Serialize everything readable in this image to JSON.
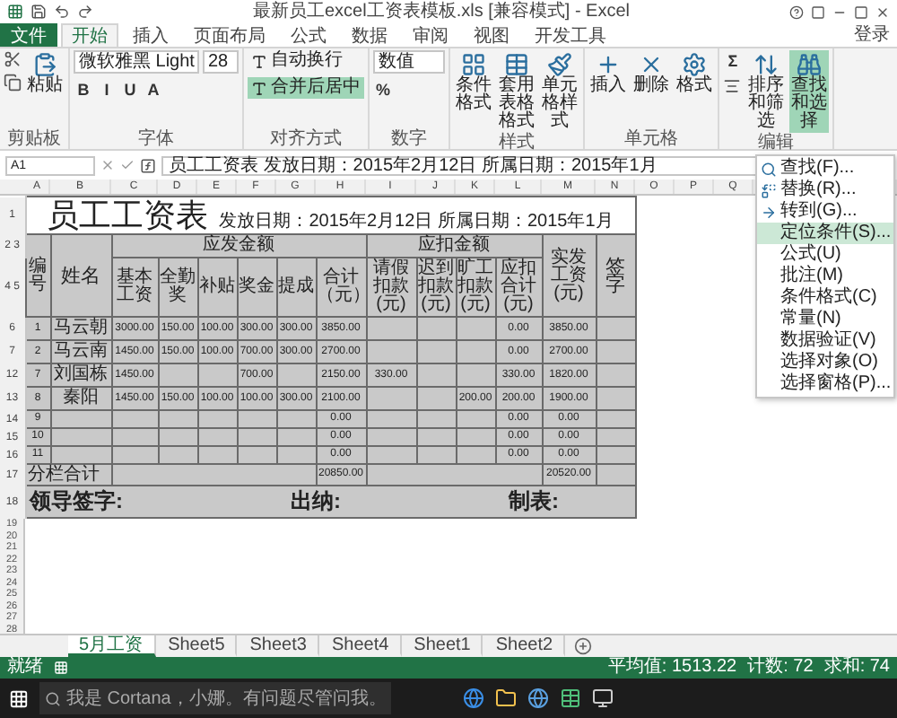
{
  "window": {
    "title": "最新员工excel工资表模板.xls [兼容模式] - Excel"
  },
  "menu_tabs": [
    {
      "label": "文件",
      "kind": "file",
      "selected": false
    },
    {
      "label": "开始",
      "kind": "tab",
      "selected": true
    },
    {
      "label": "插入",
      "kind": "tab",
      "selected": false
    },
    {
      "label": "页面布局",
      "kind": "tab",
      "selected": false
    },
    {
      "label": "公式",
      "kind": "tab",
      "selected": false
    },
    {
      "label": "数据",
      "kind": "tab",
      "selected": false
    },
    {
      "label": "审阅",
      "kind": "tab",
      "selected": false
    },
    {
      "label": "视图",
      "kind": "tab",
      "selected": false
    },
    {
      "label": "开发工具",
      "kind": "tab",
      "selected": false
    }
  ],
  "login": "登录",
  "ribbon": [
    {
      "label": "剪贴板",
      "items": [
        {
          "kind": "big",
          "label": "粘贴",
          "selected": false
        }
      ],
      "rows": [
        [
          {
            "kind": "icon"
          }
        ],
        [
          {
            "kind": "icon"
          }
        ]
      ]
    },
    {
      "label": "字体",
      "fields": [
        {
          "kind": "font",
          "value": "微软雅黑 Light"
        },
        {
          "kind": "size",
          "value": "28"
        }
      ],
      "buttons": [
        {
          "kind": "glyph",
          "label": "B"
        },
        {
          "kind": "glyph",
          "label": "I"
        },
        {
          "kind": "glyph",
          "label": "U"
        },
        {
          "kind": "glyph",
          "label": "A"
        }
      ]
    },
    {
      "label": "对齐方式",
      "rows": [
        [
          {
            "kind": "wide",
            "label": "自动换行",
            "selected": false
          }
        ],
        [
          {
            "kind": "wide",
            "label": "合并后居中",
            "selected": true
          }
        ]
      ]
    },
    {
      "label": "数字",
      "rows": [
        [
          {
            "kind": "format",
            "value": "数值"
          }
        ],
        [
          {
            "kind": "glyph",
            "label": "%"
          }
        ]
      ]
    },
    {
      "label": "样式",
      "items": [
        {
          "kind": "big",
          "label": "条件格式",
          "selected": false
        },
        {
          "kind": "big",
          "label": "套用表格格式",
          "selected": false
        },
        {
          "kind": "big",
          "label": "单元格样式",
          "selected": false
        }
      ]
    },
    {
      "label": "单元格",
      "items": [
        {
          "kind": "big",
          "label": "插入",
          "selected": false
        },
        {
          "kind": "big",
          "label": "删除",
          "selected": false
        },
        {
          "kind": "big",
          "label": "格式",
          "selected": false
        }
      ]
    },
    {
      "label": "编辑",
      "rows": [
        [
          {
            "kind": "glyph",
            "label": "Σ"
          }
        ],
        [
          {
            "kind": "icon"
          }
        ]
      ],
      "items": [
        {
          "kind": "big",
          "label": "排序和筛选",
          "selected": false
        },
        {
          "kind": "big",
          "label": "查找和选择",
          "selected": true
        }
      ]
    }
  ],
  "formula_bar": {
    "cell": "A1",
    "content": "员工工资表  发放日期：2015年2月12日  所属日期：2015年1月"
  },
  "column_letters": [
    "A",
    "B",
    "C",
    "D",
    "E",
    "F",
    "G",
    "H",
    "I",
    "J",
    "K",
    "L",
    "M",
    "N",
    "O",
    "P",
    "Q"
  ],
  "sheet": {
    "title_row": {
      "num": "1",
      "title": "员工工资表",
      "subtitle": "发放日期：2015年2月12日 所属日期：2015年1月"
    },
    "group_row_nums": [
      "2",
      "3"
    ],
    "label_row_nums": [
      "4",
      "5"
    ],
    "groups": [
      "应发金额",
      "应扣金额"
    ],
    "columns": [
      "编号",
      "姓名",
      "基本工资",
      "全勤奖",
      "补贴",
      "奖金",
      "提成",
      "合计（元）",
      "请假扣款(元)",
      "迟到扣款(元)",
      "旷工扣款(元)",
      "应扣合计(元)",
      "实发工资(元)",
      "签字"
    ],
    "rows": [
      {
        "num": "6",
        "cells": [
          "1",
          "马云朝",
          "3000.00",
          "150.00",
          "100.00",
          "300.00",
          "300.00",
          "3850.00",
          "",
          "",
          "",
          "0.00",
          "3850.00",
          ""
        ]
      },
      {
        "num": "7",
        "cells": [
          "2",
          "马云南",
          "1450.00",
          "150.00",
          "100.00",
          "700.00",
          "300.00",
          "2700.00",
          "",
          "",
          "",
          "0.00",
          "2700.00",
          ""
        ]
      },
      {
        "num": "12",
        "cells": [
          "7",
          "刘国栋",
          "1450.00",
          "",
          "",
          "700.00",
          "",
          "2150.00",
          "330.00",
          "",
          "",
          "330.00",
          "1820.00",
          ""
        ]
      },
      {
        "num": "13",
        "cells": [
          "8",
          "秦阳",
          "1450.00",
          "150.00",
          "100.00",
          "100.00",
          "300.00",
          "2100.00",
          "",
          "",
          "200.00",
          "200.00",
          "1900.00",
          ""
        ]
      },
      {
        "num": "14",
        "cells": [
          "9",
          "",
          "",
          "",
          "",
          "",
          "",
          "0.00",
          "",
          "",
          "",
          "0.00",
          "0.00",
          ""
        ]
      },
      {
        "num": "15",
        "cells": [
          "10",
          "",
          "",
          "",
          "",
          "",
          "",
          "0.00",
          "",
          "",
          "",
          "0.00",
          "0.00",
          ""
        ]
      },
      {
        "num": "16",
        "cells": [
          "11",
          "",
          "",
          "",
          "",
          "",
          "",
          "0.00",
          "",
          "",
          "",
          "0.00",
          "0.00",
          ""
        ]
      }
    ],
    "total_row": {
      "num": "17",
      "label": "分栏合计",
      "total": "20850.00",
      "net": "20520.00"
    },
    "sign_row": {
      "num": "18",
      "items": [
        "领导签字:",
        "出纳:",
        "制表:"
      ]
    },
    "empty_rows": [
      "19",
      "20",
      "21",
      "22",
      "23",
      "24",
      "25",
      "26",
      "27",
      "28"
    ]
  },
  "dropdown": [
    {
      "label": "查找(F)...",
      "selected": false
    },
    {
      "label": "替换(R)...",
      "selected": false
    },
    {
      "label": "转到(G)...",
      "selected": false
    },
    {
      "label": "定位条件(S)...",
      "selected": true
    },
    {
      "label": "公式(U)",
      "selected": false
    },
    {
      "label": "批注(M)",
      "selected": false
    },
    {
      "label": "条件格式(C)",
      "selected": false
    },
    {
      "label": "常量(N)",
      "selected": false
    },
    {
      "label": "数据验证(V)",
      "selected": false
    },
    {
      "label": "选择对象(O)",
      "selected": false
    },
    {
      "label": "选择窗格(P)...",
      "selected": false
    }
  ],
  "sheet_tabs": [
    {
      "label": "5月工资",
      "selected": true
    },
    {
      "label": "Sheet5",
      "selected": false
    },
    {
      "label": "Sheet3",
      "selected": false
    },
    {
      "label": "Sheet4",
      "selected": false
    },
    {
      "label": "Sheet1",
      "selected": false
    },
    {
      "label": "Sheet2",
      "selected": false
    }
  ],
  "status_bar": {
    "mode": "就绪",
    "average": "平均值: 1513.22",
    "count": "计数: 72",
    "sum": "求和: 74"
  },
  "taskbar": {
    "search": "我是 Cortana，小娜。有问题尽管问我。"
  }
}
